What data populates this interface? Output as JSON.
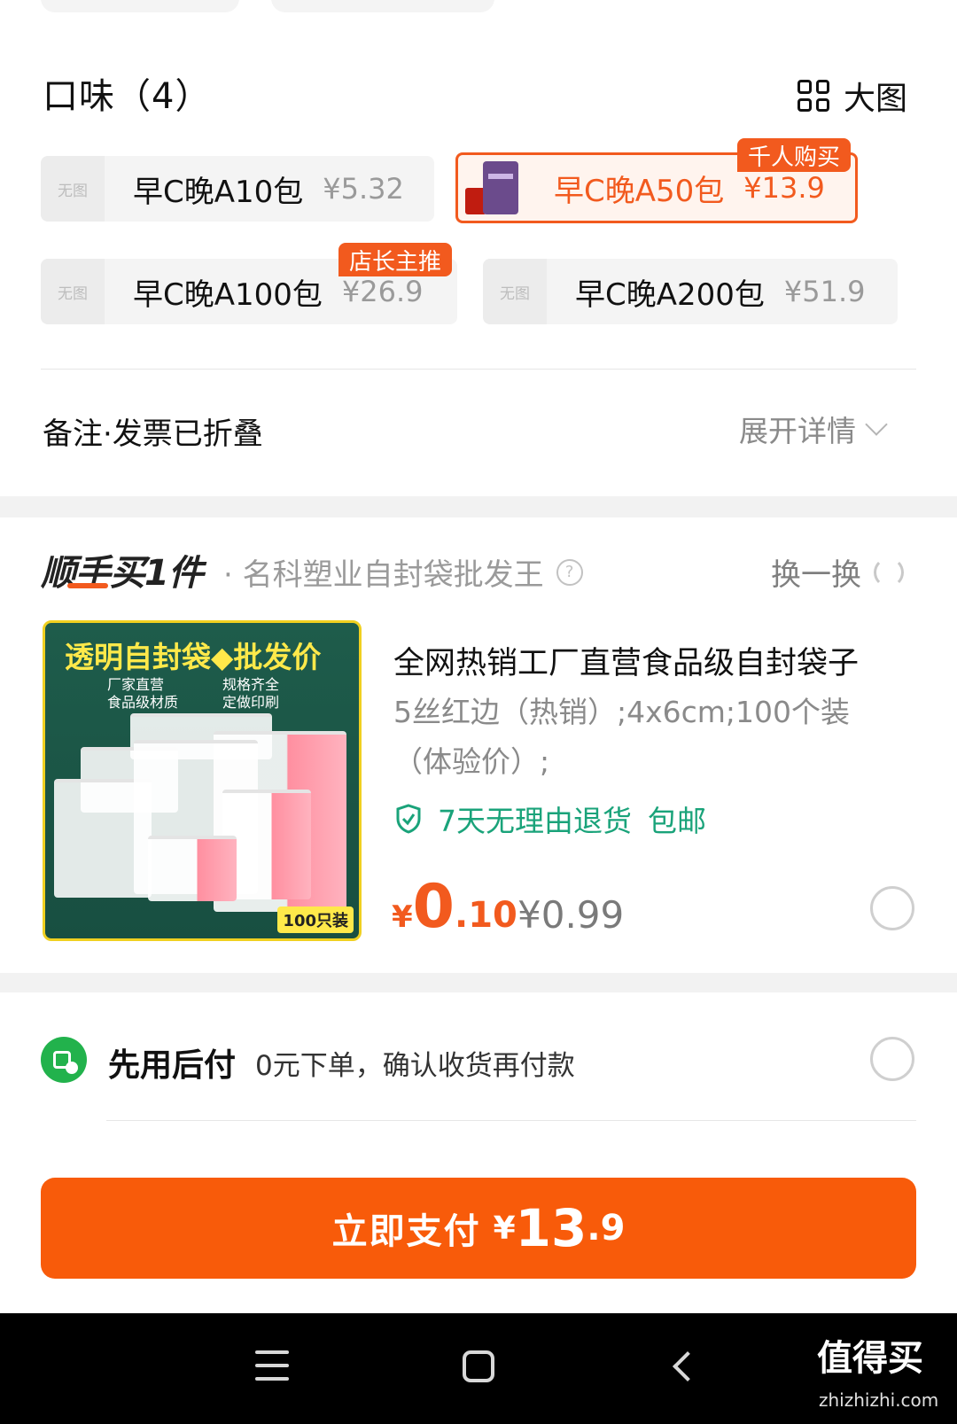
{
  "flavor": {
    "title": "口味（4）",
    "view_toggle_label": "大图",
    "options": [
      {
        "name": "早C晚A10包",
        "price": "¥5.32",
        "thumb": "无图",
        "tag": "",
        "selected": false
      },
      {
        "name": "早C晚A50包",
        "price": "¥13.9",
        "thumb": "",
        "tag": "千人购买",
        "selected": true
      },
      {
        "name": "早C晚A100包",
        "price": "¥26.9",
        "thumb": "无图",
        "tag": "店长主推",
        "selected": false
      },
      {
        "name": "早C晚A200包",
        "price": "¥51.9",
        "thumb": "无图",
        "tag": "",
        "selected": false
      }
    ]
  },
  "notes": {
    "label": "备注·发票已折叠",
    "expand_label": "展开详情"
  },
  "addon": {
    "logo": "顺手买1件",
    "shop": "· 名科塑业自封袋批发王",
    "swap_label": "换一换",
    "product": {
      "image_banner": "透明自封袋◆批发价",
      "image_features": [
        "厂家直营",
        "规格齐全",
        "食品级材质",
        "定做印刷"
      ],
      "image_count": "100只装",
      "title": "全网热销工厂直营食品级自封袋子",
      "spec_line1": "5丝红边（热销）;4x6cm;100个装",
      "spec_line2": "（体验价）;",
      "guarantee": "7天无理由退货",
      "shipping": "包邮",
      "price_symbol": "¥",
      "price_int": "0",
      "price_dec": ".10",
      "price_original": "¥0.99"
    }
  },
  "pay_later": {
    "title": "先用后付",
    "desc": "0元下单，确认收货再付款"
  },
  "pay_button": {
    "label": "立即支付",
    "symbol": "¥",
    "amount_int": "13",
    "amount_dec": ".9"
  },
  "watermark": {
    "text": "值得买",
    "url": "zhizhizhi.com"
  },
  "colors": {
    "accent": "#f25a1e",
    "pay_button": "#f85b0a",
    "guarantee_green": "#1aa37a",
    "pay_later_green": "#22b24c"
  }
}
